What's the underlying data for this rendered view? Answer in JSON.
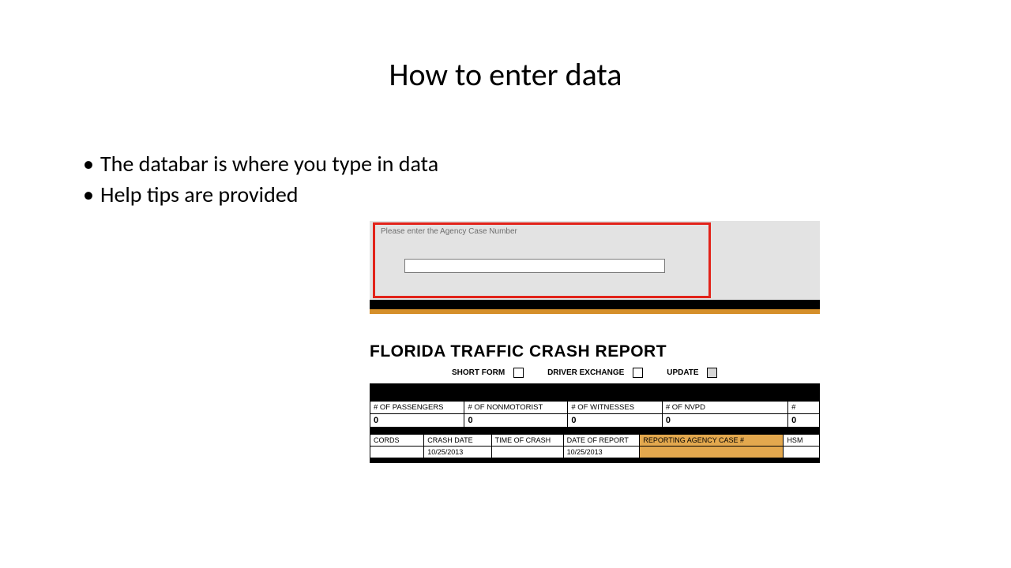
{
  "title": "How to enter data",
  "bullets": [
    "The databar is where you type in data",
    "Help tips are provided"
  ],
  "databar": {
    "help_text": "Please enter the Agency Case Number",
    "input_value": ""
  },
  "report": {
    "title": "FLORIDA TRAFFIC CRASH REPORT",
    "checks": {
      "short_form": "SHORT FORM",
      "driver_exchange": "DRIVER EXCHANGE",
      "update": "UPDATE"
    }
  },
  "counts": {
    "headers": {
      "passengers": "# OF PASSENGERS",
      "nonmotorist": "# OF NONMOTORIST",
      "witnesses": "# OF WITNESSES",
      "nvpd": "# OF NVPD",
      "extra": "#"
    },
    "values": {
      "passengers": "0",
      "nonmotorist": "0",
      "witnesses": "0",
      "nvpd": "0",
      "extra": "0"
    }
  },
  "row2": {
    "headers": {
      "cords": "CORDS",
      "crash_date": "CRASH DATE",
      "crash_time": "TIME OF CRASH",
      "report_date": "DATE OF REPORT",
      "agency_case": "REPORTING AGENCY CASE #",
      "hsm": "HSM"
    },
    "values": {
      "cords": "",
      "crash_date": "10/25/2013",
      "crash_time": "",
      "report_date": "10/25/2013",
      "agency_case": "",
      "hsm": ""
    }
  }
}
